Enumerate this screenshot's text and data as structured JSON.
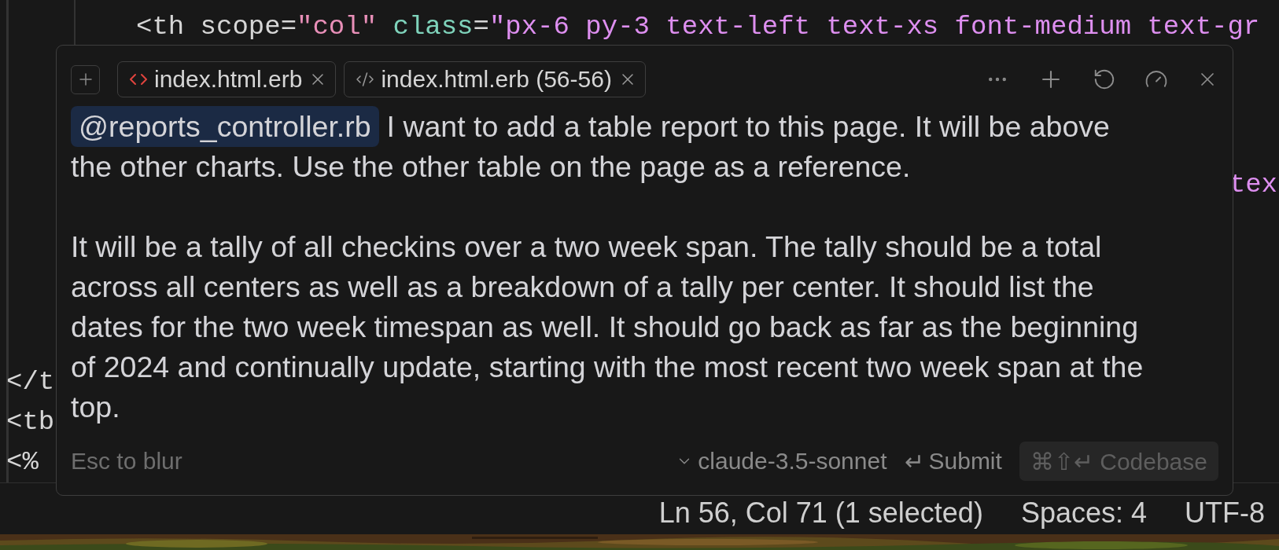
{
  "editor": {
    "lines": [
      {
        "kind": "code",
        "tokens": [
          {
            "text": "<th",
            "kind": "tag"
          },
          {
            "text": " scope",
            "kind": "attr"
          },
          {
            "text": "=",
            "kind": "punct"
          },
          {
            "text": "\"col\"",
            "kind": "string"
          },
          {
            "text": " class",
            "kind": "attr-alt"
          },
          {
            "text": "=",
            "kind": "punct"
          },
          {
            "text": "\"px-6 py-3 text-left text-xs font-medium text-gr",
            "kind": "class-string"
          }
        ]
      },
      {
        "kind": "empty"
      },
      {
        "kind": "empty"
      },
      {
        "kind": "empty"
      },
      {
        "kind": "tail",
        "tokens": [
          {
            "text": "tex",
            "kind": "class-string"
          }
        ]
      },
      {
        "kind": "empty"
      },
      {
        "kind": "empty"
      },
      {
        "kind": "empty"
      },
      {
        "kind": "empty"
      },
      {
        "kind": "head",
        "tokens": [
          {
            "text": "</t",
            "kind": "tag"
          }
        ]
      },
      {
        "kind": "head",
        "tokens": [
          {
            "text": "<tb",
            "kind": "tag"
          }
        ]
      },
      {
        "kind": "head",
        "tokens": [
          {
            "text": "<%",
            "kind": "tag"
          }
        ]
      }
    ]
  },
  "composer": {
    "context_tabs": [
      {
        "kind": "file",
        "label": "index.html.erb"
      },
      {
        "kind": "selection",
        "label": "index.html.erb (56-56)"
      }
    ],
    "message": [
      {
        "mention": "@reports_controller.rb",
        "text": "I want to add a table report to this page. It will be above\nthe other charts. Use the other table on the page as a reference."
      },
      {
        "text": "It will be a tally of all checkins over a two week span. The tally should be a total\nacross all centers as well as a breakdown of a tally per center. It should list the\ndates for the two week timespan as well. It should go back as far as the beginning\nof 2024 and continually update, starting with the most recent two week span at the\ntop."
      }
    ],
    "hint": "Esc to blur",
    "model": "claude-3.5-sonnet",
    "submit": {
      "key": "↵",
      "label": "Submit"
    },
    "codebase": {
      "key": "⌘⇧↵",
      "label": "Codebase"
    }
  },
  "status_bar": [
    "Ln 56, Col 71 (1 selected)",
    "Spaces: 4",
    "UTF-8"
  ]
}
